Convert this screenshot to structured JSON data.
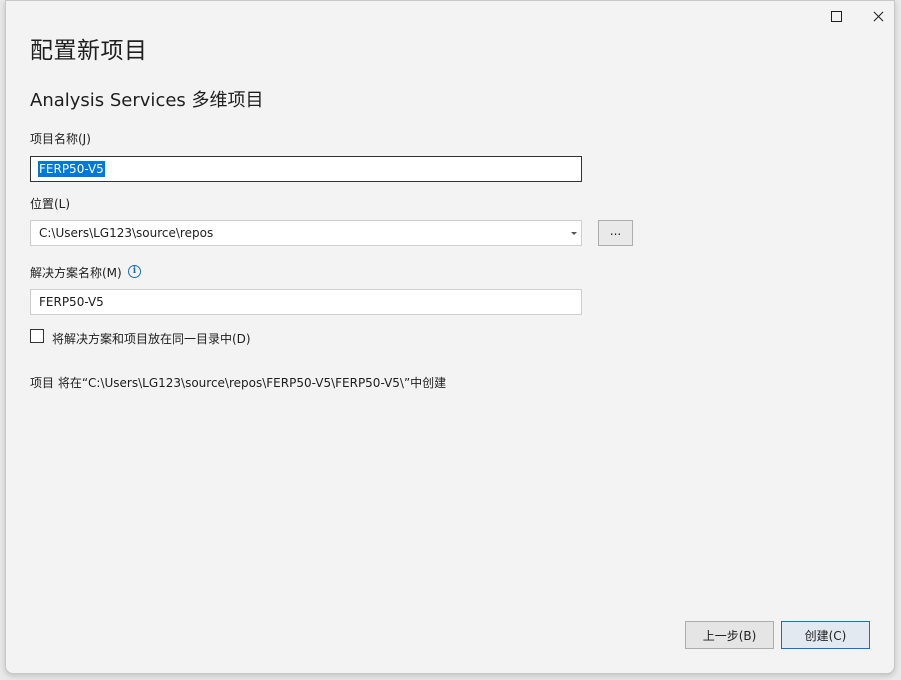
{
  "window": {
    "maximize_label": "",
    "close_label": ""
  },
  "header": {
    "title": "配置新项目",
    "subtitle": "Analysis Services 多维项目"
  },
  "form": {
    "project_name_label": "项目名称(J)",
    "project_name_value": "FERP50-V5",
    "location_label": "位置(L)",
    "location_value": "C:\\Users\\LG123\\source\\repos",
    "browse_label": "...",
    "solution_name_label": "解决方案名称(M)",
    "solution_name_value": "FERP50-V5",
    "same_dir_label": "将解决方案和项目放在同一目录中(D)",
    "same_dir_checked": false,
    "path_note": "项目 将在“C:\\Users\\LG123\\source\\repos\\FERP50-V5\\FERP50-V5\\”中创建"
  },
  "footer": {
    "back_label": "上一步(B)",
    "create_label": "创建(C)"
  },
  "icons": {
    "info": "info-icon",
    "maximize": "maximize-icon",
    "close": "close-icon",
    "dropdown": "chevron-down-icon"
  },
  "colors": {
    "accent": "#0078d7",
    "info": "#1a6fb5"
  }
}
